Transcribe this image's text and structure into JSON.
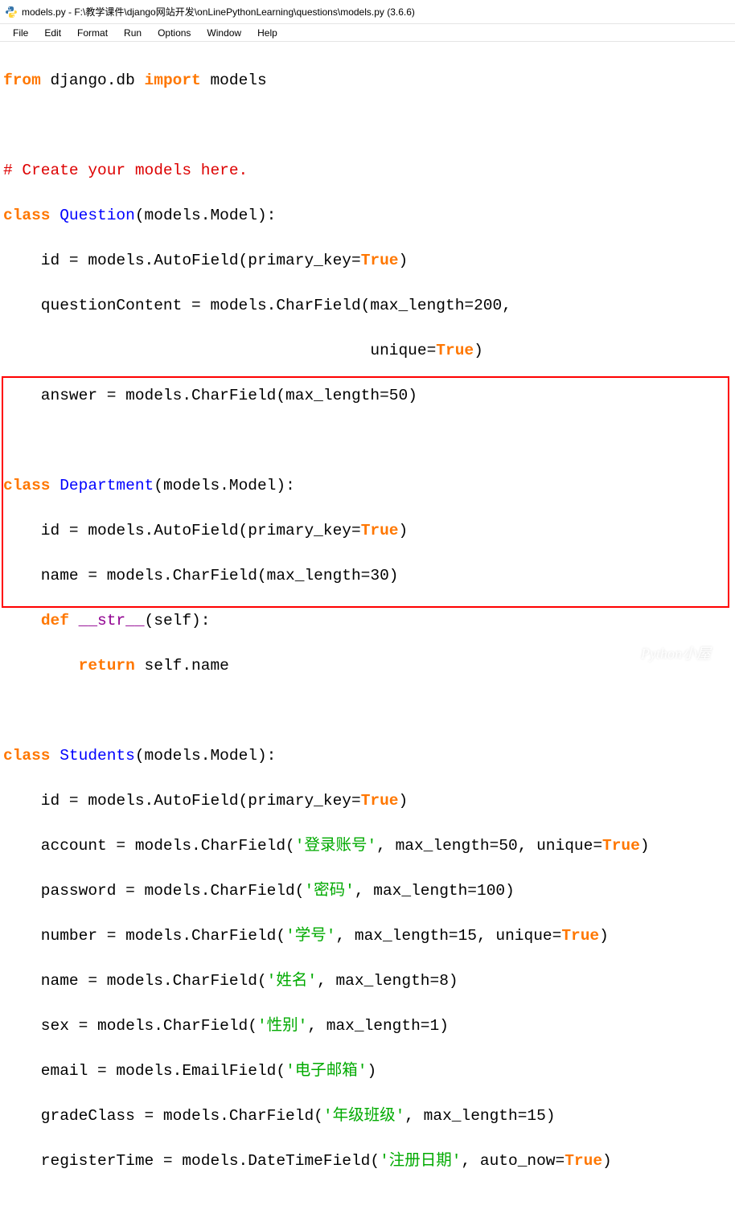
{
  "titlebar": {
    "text": "models.py - F:\\教学课件\\django网站开发\\onLinePythonLearning\\questions\\models.py (3.6.6)"
  },
  "menubar": {
    "file": "File",
    "edit": "Edit",
    "format": "Format",
    "run": "Run",
    "options": "Options",
    "window": "Window",
    "help": "Help"
  },
  "code": {
    "l1": {
      "a": "from",
      "b": " django.db ",
      "c": "import",
      "d": " models"
    },
    "l2": "",
    "l3": "# Create your models here.",
    "l4": {
      "a": "class",
      "b": " ",
      "c": "Question",
      "d": "(models.Model):"
    },
    "l5": {
      "a": "    id = models.AutoField(primary_key=",
      "b": "True",
      "c": ")"
    },
    "l6": {
      "a": "    questionContent = models.CharField(max_length=",
      "b": "200",
      "c": ","
    },
    "l7": {
      "a": "                                       unique=",
      "b": "True",
      "c": ")"
    },
    "l8": {
      "a": "    answer = models.CharField(max_length=",
      "b": "50",
      "c": ")"
    },
    "l9": "",
    "l10": {
      "a": "class",
      "b": " ",
      "c": "Department",
      "d": "(models.Model):"
    },
    "l11": {
      "a": "    id = models.AutoField(primary_key=",
      "b": "True",
      "c": ")"
    },
    "l12": {
      "a": "    name = models.CharField(max_length=",
      "b": "30",
      "c": ")"
    },
    "l13": {
      "a": "    ",
      "b": "def",
      "c": " ",
      "d": "__str__",
      "e": "(self):"
    },
    "l14": {
      "a": "        ",
      "b": "return",
      "c": " self.name"
    },
    "l15": "",
    "l16": {
      "a": "class",
      "b": " ",
      "c": "Students",
      "d": "(models.Model):"
    },
    "l17": {
      "a": "    id = models.AutoField(primary_key=",
      "b": "True",
      "c": ")"
    },
    "l18": {
      "a": "    account = models.CharField(",
      "b": "'登录账号'",
      "c": ", max_length=",
      "d": "50",
      "e": ", unique=",
      "f": "True",
      "g": ")"
    },
    "l19": {
      "a": "    password = models.CharField(",
      "b": "'密码'",
      "c": ", max_length=",
      "d": "100",
      "e": ")"
    },
    "l20": {
      "a": "    number = models.CharField(",
      "b": "'学号'",
      "c": ", max_length=",
      "d": "15",
      "e": ", unique=",
      "f": "True",
      "g": ")"
    },
    "l21": {
      "a": "    name = models.CharField(",
      "b": "'姓名'",
      "c": ", max_length=",
      "d": "8",
      "e": ")"
    },
    "l22": {
      "a": "    sex = models.CharField(",
      "b": "'性别'",
      "c": ", max_length=",
      "d": "1",
      "e": ")"
    },
    "l23": {
      "a": "    email = models.EmailField(",
      "b": "'电子邮箱'",
      "c": ")"
    },
    "l24": {
      "a": "    gradeClass = models.CharField(",
      "b": "'年级班级'",
      "c": ", max_length=",
      "d": "15",
      "e": ")"
    },
    "l25": {
      "a": "    registerTime = models.DateTimeField(",
      "b": "'注册日期'",
      "c": ", auto_now=",
      "d": "True",
      "e": ")"
    }
  },
  "watermark": {
    "text": "Python小屋"
  }
}
